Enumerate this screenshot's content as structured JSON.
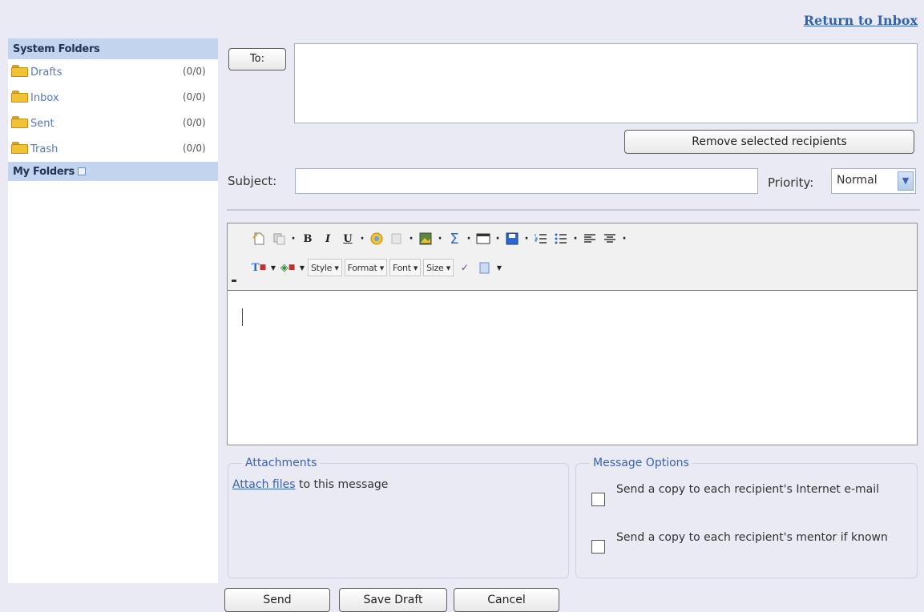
{
  "header": {
    "return_link": "Return to Inbox"
  },
  "sidebar": {
    "system_folders_title": "System Folders",
    "folders": [
      {
        "name": "Drafts",
        "count": "(0/0)"
      },
      {
        "name": "Inbox",
        "count": "(0/0)"
      },
      {
        "name": "Sent",
        "count": "(0/0)"
      },
      {
        "name": "Trash",
        "count": "(0/0)"
      }
    ],
    "my_folders_title": "My Folders"
  },
  "compose": {
    "to_button": "To:",
    "to_value": "",
    "remove_button": "Remove selected recipients",
    "subject_label": "Subject:",
    "subject_value": "",
    "priority_label": "Priority:",
    "priority_value": "Normal"
  },
  "editor": {
    "toolbar": {
      "style_label": "Style",
      "format_label": "Format",
      "font_label": "Font",
      "size_label": "Size"
    },
    "body_text": ""
  },
  "attachments": {
    "title": "Attachments",
    "link_text": "Attach files",
    "suffix_text": " to this message"
  },
  "options": {
    "title": "Message Options",
    "option1": "Send a copy to each recipient's Internet e-mail",
    "option2": "Send a copy to each recipient's mentor if known"
  },
  "actions": {
    "send": "Send",
    "save_draft": "Save Draft",
    "cancel": "Cancel"
  },
  "colors": {
    "background": "#e9eaf4",
    "sidebar_header": "#c2d4ee",
    "link": "#2f63b8",
    "folder_yellow": "#f2c232"
  },
  "icons": [
    "folder-icon",
    "my-folders-icon",
    "chevron-down-icon",
    "new-document-icon",
    "copy-icon",
    "bold-icon",
    "italic-icon",
    "underline-icon",
    "link-icon",
    "image-icon",
    "sigma-icon",
    "table-icon",
    "save-icon",
    "numbered-list-icon",
    "bullet-list-icon",
    "align-left-icon",
    "align-center-icon",
    "text-color-icon",
    "highlight-color-icon",
    "spellcheck-icon",
    "paste-icon"
  ]
}
